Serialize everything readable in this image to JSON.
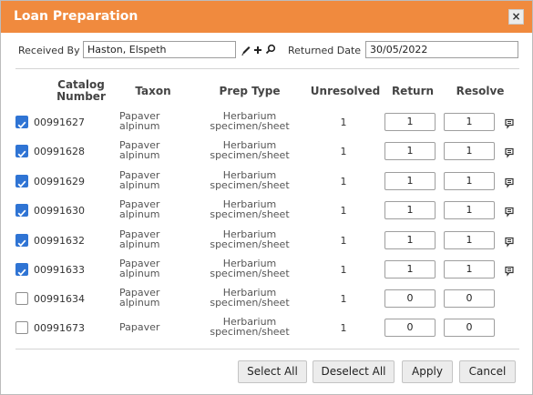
{
  "dialog": {
    "title": "Loan Preparation",
    "close_label": "×"
  },
  "form": {
    "received_by_label": "Received By",
    "received_by_value": "Haston, Elspeth",
    "returned_date_label": "Returned Date",
    "returned_date_value": "30/05/2022"
  },
  "table": {
    "headers": {
      "catalog_line1": "Catalog",
      "catalog_line2": "Number",
      "taxon": "Taxon",
      "prep_type": "Prep Type",
      "unresolved": "Unresolved",
      "return": "Return",
      "resolve": "Resolve"
    },
    "rows": [
      {
        "checked": true,
        "catalog": "00991627",
        "taxon_l1": "Papaver",
        "taxon_l2": "alpinum",
        "prep_l1": "Herbarium",
        "prep_l2": "specimen/sheet",
        "unresolved": "1",
        "return": "1",
        "resolve": "1",
        "comment": true
      },
      {
        "checked": true,
        "catalog": "00991628",
        "taxon_l1": "Papaver",
        "taxon_l2": "alpinum",
        "prep_l1": "Herbarium",
        "prep_l2": "specimen/sheet",
        "unresolved": "1",
        "return": "1",
        "resolve": "1",
        "comment": true
      },
      {
        "checked": true,
        "catalog": "00991629",
        "taxon_l1": "Papaver",
        "taxon_l2": "alpinum",
        "prep_l1": "Herbarium",
        "prep_l2": "specimen/sheet",
        "unresolved": "1",
        "return": "1",
        "resolve": "1",
        "comment": true
      },
      {
        "checked": true,
        "catalog": "00991630",
        "taxon_l1": "Papaver",
        "taxon_l2": "alpinum",
        "prep_l1": "Herbarium",
        "prep_l2": "specimen/sheet",
        "unresolved": "1",
        "return": "1",
        "resolve": "1",
        "comment": true
      },
      {
        "checked": true,
        "catalog": "00991632",
        "taxon_l1": "Papaver",
        "taxon_l2": "alpinum",
        "prep_l1": "Herbarium",
        "prep_l2": "specimen/sheet",
        "unresolved": "1",
        "return": "1",
        "resolve": "1",
        "comment": true
      },
      {
        "checked": true,
        "catalog": "00991633",
        "taxon_l1": "Papaver",
        "taxon_l2": "alpinum",
        "prep_l1": "Herbarium",
        "prep_l2": "specimen/sheet",
        "unresolved": "1",
        "return": "1",
        "resolve": "1",
        "comment": true
      },
      {
        "checked": false,
        "catalog": "00991634",
        "taxon_l1": "Papaver",
        "taxon_l2": "alpinum",
        "prep_l1": "Herbarium",
        "prep_l2": "specimen/sheet",
        "unresolved": "1",
        "return": "0",
        "resolve": "0",
        "comment": false
      },
      {
        "checked": false,
        "catalog": "00991673",
        "taxon_l1": "Papaver",
        "taxon_l2": "",
        "prep_l1": "Herbarium",
        "prep_l2": "specimen/sheet",
        "unresolved": "1",
        "return": "0",
        "resolve": "0",
        "comment": false
      }
    ]
  },
  "buttons": {
    "select_all": "Select All",
    "deselect_all": "Deselect All",
    "apply": "Apply",
    "cancel": "Cancel"
  },
  "colors": {
    "title_bar": "#f08a3e",
    "checkbox": "#2f74d4"
  }
}
